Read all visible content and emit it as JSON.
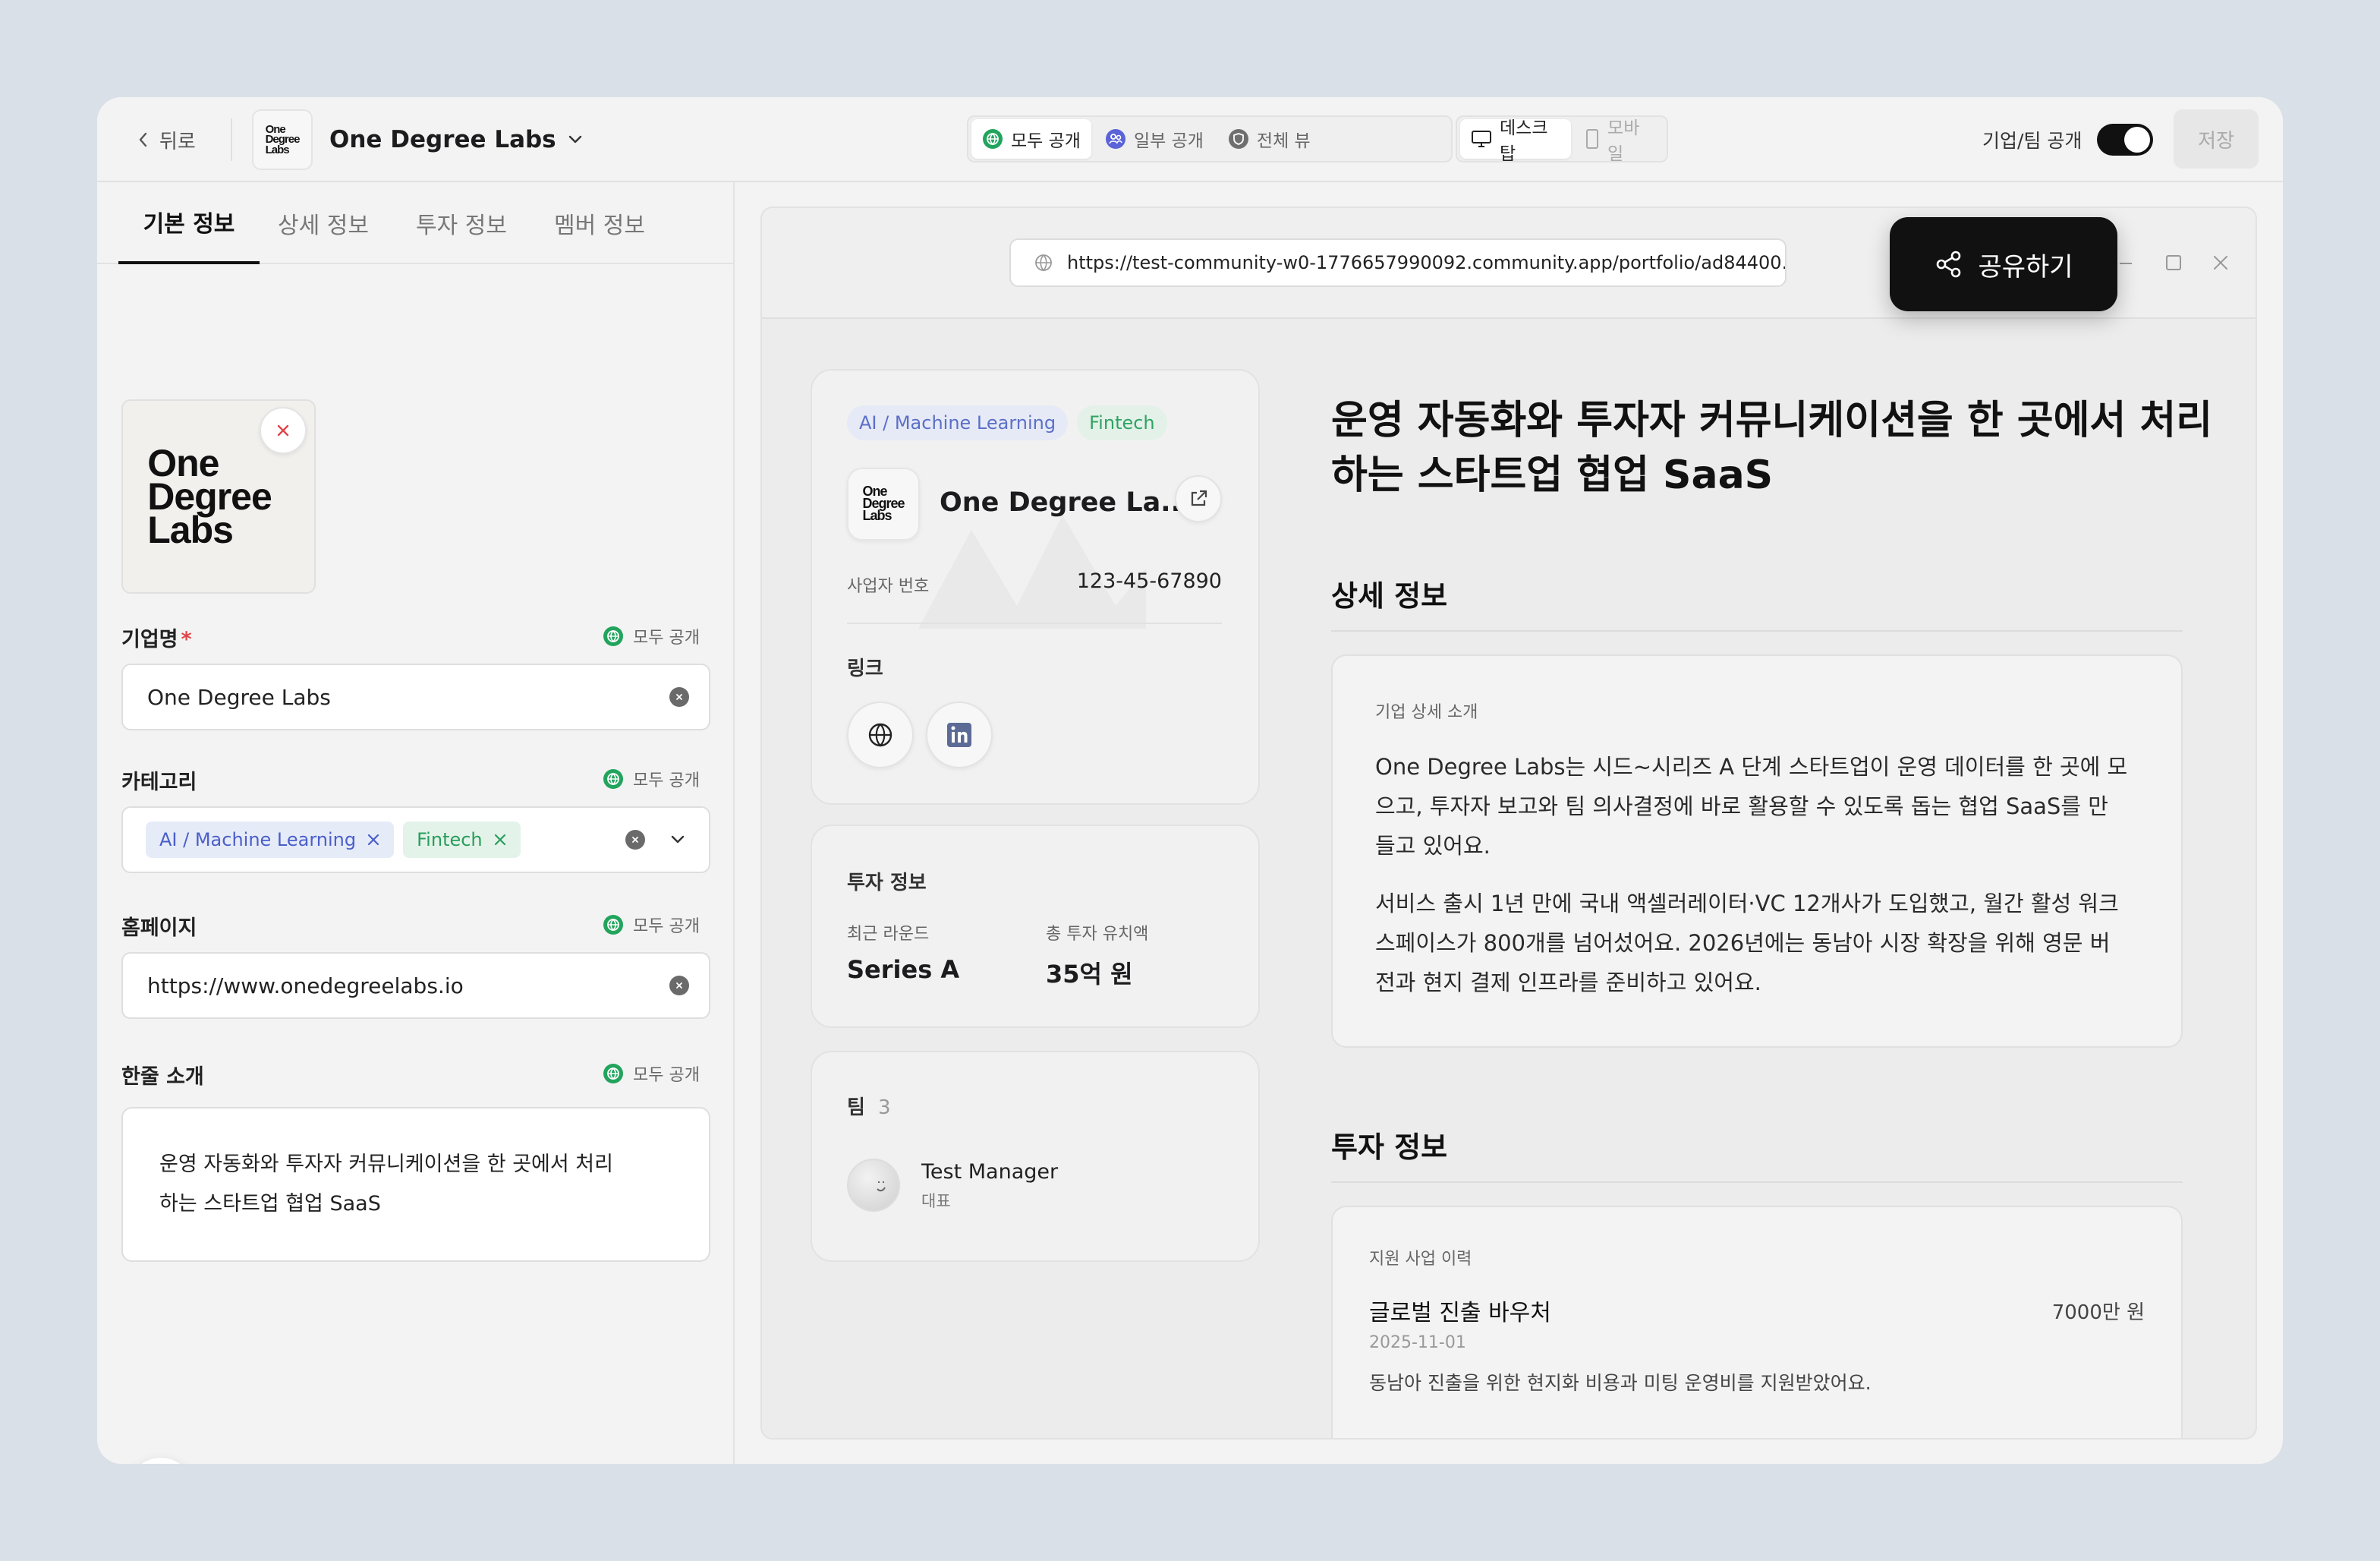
{
  "topbar": {
    "back_label": "뒤로",
    "logo_text": [
      "One",
      "Degree",
      "Labs"
    ],
    "company_name": "One Degree Labs",
    "visibility_options": [
      "모두 공개",
      "일부 공개",
      "전체 뷰"
    ],
    "device_options": [
      "데스크탑",
      "모바일"
    ],
    "toggle_label": "기업/팀 공개",
    "save_label": "저장"
  },
  "left": {
    "tabs": [
      "기본 정보",
      "상세 정보",
      "투자 정보",
      "멤버 정보"
    ],
    "logo_text": [
      "One",
      "Degree",
      "Labs"
    ],
    "fields": {
      "name": {
        "label": "기업명",
        "required": "*",
        "visibility": "모두 공개",
        "value": "One Degree Labs"
      },
      "category": {
        "label": "카테고리",
        "visibility": "모두 공개",
        "tags": [
          "AI / Machine Learning",
          "Fintech"
        ]
      },
      "homepage": {
        "label": "홈페이지",
        "visibility": "모두 공개",
        "value": "https://www.onedegreelabs.io"
      },
      "intro": {
        "label": "한줄 소개",
        "visibility": "모두 공개",
        "lines": [
          "운영 자동화와 투자자 커뮤니케이션을 한 곳에서 처리",
          "하는 스타트업 협업 SaaS"
        ]
      }
    }
  },
  "preview": {
    "url": "https://test-community-w0-1776657990092.community.app/portfolio/ad84400...",
    "share_label": "공유하기",
    "profile": {
      "tags": [
        "AI / Machine Learning",
        "Fintech"
      ],
      "logo_text": [
        "One",
        "Degree",
        "Labs"
      ],
      "name": "One Degree La...",
      "biz_label": "사업자 번호",
      "biz_number": "123-45-67890",
      "links_label": "링크"
    },
    "investment_card": {
      "title": "투자 정보",
      "round_label": "최근 라운드",
      "round_value": "Series A",
      "total_label": "총 투자 유치액",
      "total_value": "35억 원"
    },
    "team_card": {
      "title": "팀",
      "count": "3",
      "member_name": "Test Manager",
      "member_role": "대표"
    },
    "headline": [
      "운영 자동화와 투자자 커뮤니케이션을 한 곳에서 처리",
      "하는 스타트업 협업 SaaS"
    ],
    "detail": {
      "heading": "상세 정보",
      "box_label": "기업 상세 소개",
      "p1": [
        "One Degree Labs는 시드~시리즈 A 단계 스타트업이 운영 데이터를 한 곳에 모",
        "으고, 투자자 보고와 팀 의사결정에 바로 활용할 수 있도록 돕는 협업 SaaS를 만",
        "들고 있어요."
      ],
      "p2": [
        "서비스 출시 1년 만에 국내 액셀러레이터·VC 12개사가 도입했고, 월간 활성 워크",
        "스페이스가 800개를 넘어섰어요. 2026년에는 동남아 시장 확장을 위해 영문 버",
        "전과 현지 결제 인프라를 준비하고 있어요."
      ]
    },
    "invest": {
      "heading": "투자 정보",
      "box_label": "지원 사업 이력",
      "program_name": "글로벌 진출 바우처",
      "program_amount": "7000만 원",
      "program_date": "2025-11-01",
      "program_desc": "동남아 진출을 위한 현지화 비용과 미팅 운영비를 지원받았어요."
    }
  },
  "colors": {
    "accent_blue": "#5b6fc8",
    "accent_green": "#2fa363",
    "dark": "#111111"
  }
}
